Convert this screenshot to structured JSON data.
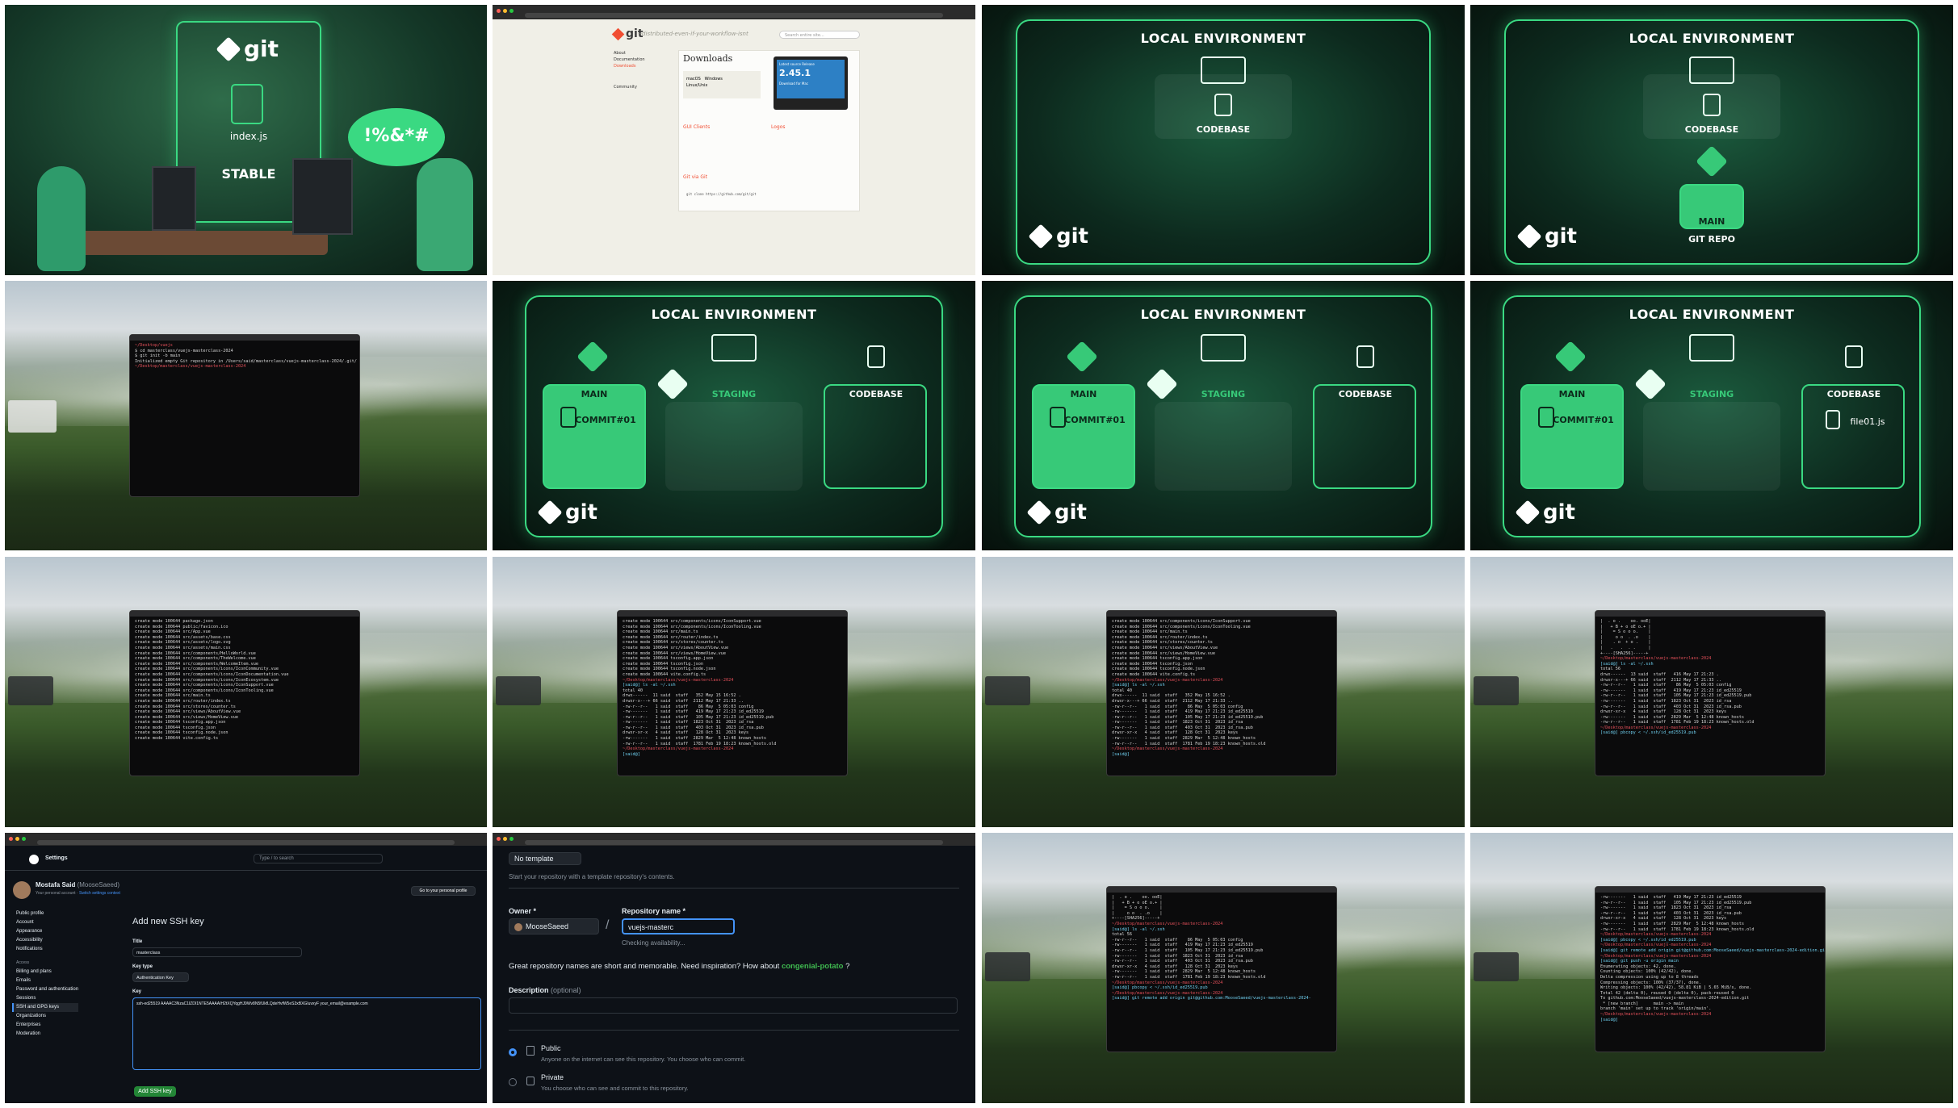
{
  "tile1": {
    "brand": "git",
    "file": "index.js",
    "status": "STABLE",
    "speech": "!%&*#"
  },
  "tile2": {
    "brand": "git",
    "tagline": "--distributed-even-if-your-workflow-isnt",
    "search_placeholder": "Search entire site...",
    "heading": "Downloads",
    "nav": [
      "About",
      "Documentation",
      "Downloads",
      "Community"
    ],
    "platforms": [
      "macOS",
      "Windows",
      "Linux/Unix"
    ],
    "release_label": "Latest source Release",
    "version": "2.45.1",
    "release_button": "Download for Mac",
    "gui_title": "GUI Clients",
    "logos_title": "Logos",
    "git_via_git": "Git via Git",
    "clone_cmd": "git clone https://github.com/git/git"
  },
  "slides": {
    "local_env": "LOCAL ENVIRONMENT",
    "codebase": "CODEBASE",
    "main": "MAIN",
    "git_repo": "GIT REPO",
    "staging": "STAGING",
    "commit": "COMMIT#01",
    "file": "file01.js",
    "brand": "git"
  },
  "terminals": {
    "t5": [
      {
        "p": "~/Desktop/vuejs",
        "c": ""
      },
      {
        "p": "",
        "c": "$ cd masterclass/vuejs-masterclass-2024"
      },
      {
        "p": "",
        "c": "$ git init -b main"
      },
      {
        "p": "",
        "c": "Initialized empty Git repository in /Users/said/masterclass/vuejs-masterclass-2024/.git/"
      },
      {
        "p": "~/Desktop/masterclass/vuejs-masterclass-2024",
        "c": ""
      }
    ],
    "t9": [
      "create mode 100644 package.json",
      "create mode 100644 public/favicon.ico",
      "create mode 100644 src/App.vue",
      "create mode 100644 src/assets/base.css",
      "create mode 100644 src/assets/logo.svg",
      "create mode 100644 src/assets/main.css",
      "create mode 100644 src/components/HelloWorld.vue",
      "create mode 100644 src/components/TheWelcome.vue",
      "create mode 100644 src/components/WelcomeItem.vue",
      "create mode 100644 src/components/icons/IconCommunity.vue",
      "create mode 100644 src/components/icons/IconDocumentation.vue",
      "create mode 100644 src/components/icons/IconEcosystem.vue",
      "create mode 100644 src/components/icons/IconSupport.vue",
      "create mode 100644 src/components/icons/IconTooling.vue",
      "create mode 100644 src/main.ts",
      "create mode 100644 src/router/index.ts",
      "create mode 100644 src/stores/counter.ts",
      "create mode 100644 src/views/AboutView.vue",
      "create mode 100644 src/views/HomeView.vue",
      "create mode 100644 tsconfig.app.json",
      "create mode 100644 tsconfig.json",
      "create mode 100644 tsconfig.node.json",
      "create mode 100644 vite.config.ts"
    ],
    "t10": [
      "create mode 100644 src/components/icons/IconSupport.vue",
      "create mode 100644 src/components/icons/IconTooling.vue",
      "create mode 100644 src/main.ts",
      "create mode 100644 src/router/index.ts",
      "create mode 100644 src/stores/counter.ts",
      "create mode 100644 src/views/AboutView.vue",
      "create mode 100644 src/views/HomeView.vue",
      "create mode 100644 tsconfig.app.json",
      "create mode 100644 tsconfig.json",
      "create mode 100644 tsconfig.node.json",
      "create mode 100644 vite.config.ts",
      "~/Desktop/masterclass/vuejs-masterclass-2024",
      "[said@] ls -al ~/.ssh",
      "total 40",
      "drwx------  11 said  staff   352 May 15 16:52 .",
      "drwxr-x---+ 66 said  staff  2112 May 17 21:33 ..",
      "-rw-r--r--   1 said  staff    86 May  5 05:03 config",
      "-rw-------   1 said  staff   419 May 17 21:23 id_ed25519",
      "-rw-r--r--   1 said  staff   105 May 17 21:23 id_ed25519.pub",
      "-rw-------   1 said  staff  1823 Oct 31  2023 id_rsa",
      "-rw-r--r--   1 said  staff   403 Oct 31  2023 id_rsa.pub",
      "drwxr-xr-x   4 said  staff   128 Oct 31  2023 keys",
      "-rw-------   1 said  staff  2829 Mar  5 12:48 known_hosts",
      "-rw-r--r--   1 said  staff  1781 Feb 19 18:23 known_hosts.old",
      "~/Desktop/masterclass/vuejs-masterclass-2024",
      "[said@] "
    ],
    "t12": [
      "|  . o .    oo. ooE|",
      "|   + B + o oE o.+ |",
      "|    = S o o o.    |",
      "|     o o  . .o    |",
      "|    . o  + o .    |",
      "|   .   .  . .     |",
      "+----[SHA256]-----+",
      "~/Desktop/masterclass/vuejs-masterclass-2024",
      "[said@] ls -al ~/.ssh",
      "total 56",
      "drwx------  13 said  staff   416 May 17 21:23 .",
      "drwxr-x---+ 66 said  staff  2112 May 17 21:33 ..",
      "-rw-r--r--   1 said  staff    86 May  5 05:03 config",
      "-rw-------   1 said  staff   419 May 17 21:23 id_ed25519",
      "-rw-r--r--   1 said  staff   105 May 17 21:23 id_ed25519.pub",
      "-rw-------   1 said  staff  1823 Oct 31  2023 id_rsa",
      "-rw-r--r--   1 said  staff   403 Oct 31  2023 id_rsa.pub",
      "drwxr-xr-x   4 said  staff   128 Oct 31  2023 keys",
      "-rw-------   1 said  staff  2829 Mar  5 12:48 known_hosts",
      "-rw-r--r--   1 said  staff  1781 Feb 19 18:23 known_hosts.old",
      "~/Desktop/masterclass/vuejs-masterclass-2024",
      "[said@] pbcopy < ~/.ssh/id_ed25519.pub"
    ],
    "t15": [
      "|  . o .    oo. ooE|",
      "|   + B + o oE o.+ |",
      "|    = S o o o.    |",
      "|     o o  . .o    |",
      "+----[SHA256]-----+",
      "~/Desktop/masterclass/vuejs-masterclass-2024",
      "[said@] ls -al ~/.ssh",
      "total 56",
      "-rw-r--r--   1 said  staff    86 May  5 05:03 config",
      "-rw-------   1 said  staff   419 May 17 21:23 id_ed25519",
      "-rw-r--r--   1 said  staff   105 May 17 21:23 id_ed25519.pub",
      "-rw-------   1 said  staff  1823 Oct 31  2023 id_rsa",
      "-rw-r--r--   1 said  staff   403 Oct 31  2023 id_rsa.pub",
      "drwxr-xr-x   4 said  staff   128 Oct 31  2023 keys",
      "-rw-------   1 said  staff  2829 Mar  5 12:48 known_hosts",
      "-rw-r--r--   1 said  staff  1781 Feb 19 18:23 known_hosts.old",
      "~/Desktop/masterclass/vuejs-masterclass-2024",
      "[said@] pbcopy < ~/.ssh/id_ed25519.pub",
      "~/Desktop/masterclass/vuejs-masterclass-2024",
      "[said@] git remote add origin git@github.com:MooseSaeed/vuejs-masterclass-2024-"
    ],
    "t16": [
      "-rw-------   1 said  staff   419 May 17 21:23 id_ed25519",
      "-rw-r--r--   1 said  staff   105 May 17 21:23 id_ed25519.pub",
      "-rw-------   1 said  staff  1823 Oct 31  2023 id_rsa",
      "-rw-r--r--   1 said  staff   403 Oct 31  2023 id_rsa.pub",
      "drwxr-xr-x   4 said  staff   128 Oct 31  2023 keys",
      "-rw-------   1 said  staff  2829 Mar  5 12:48 known_hosts",
      "-rw-r--r--   1 said  staff  1781 Feb 19 18:23 known_hosts.old",
      "~/Desktop/masterclass/vuejs-masterclass-2024",
      "[said@] pbcopy < ~/.ssh/id_ed25519.pub",
      "~/Desktop/masterclass/vuejs-masterclass-2024",
      "[said@] git remote add origin git@github.com:MooseSaeed/vuejs-masterclass-2024-edition.git",
      "~/Desktop/masterclass/vuejs-masterclass-2024",
      "[said@] git push -u origin main",
      "Enumerating objects: 42, done.",
      "Counting objects: 100% (42/42), done.",
      "Delta compression using up to 8 threads",
      "Compressing objects: 100% (37/37), done.",
      "Writing objects: 100% (42/42), 58.81 KiB | 5.65 MiB/s, done.",
      "Total 42 (delta 0), reused 0 (delta 0), pack-reused 0",
      "To github.com:MooseSaeed/vuejs-masterclass-2024-edition.git",
      " * [new branch]      main -> main",
      "branch 'main' set up to track 'origin/main'.",
      "~/Desktop/masterclass/vuejs-masterclass-2024",
      "[said@] "
    ]
  },
  "gh_settings": {
    "tab_title": "Add new SSH key",
    "header": "Settings",
    "search": "Type / to search",
    "user_name": "Mostafa Said",
    "user_handle": "(MooseSaeed)",
    "account_sub": "Your personal account",
    "switch": "Switch settings context",
    "profile_btn": "Go to your personal profile",
    "nav": [
      "Public profile",
      "Account",
      "Appearance",
      "Accessibility",
      "Notifications"
    ],
    "access_label": "Access",
    "nav2": [
      "Billing and plans",
      "Emails",
      "Password and authentication",
      "Sessions",
      "SSH and GPG keys",
      "Organizations",
      "Enterprises",
      "Moderation"
    ],
    "page_title": "Add new SSH key",
    "title_label": "Title",
    "title_value": "masterclass",
    "keytype_label": "Key type",
    "keytype_value": "Authentication Key",
    "key_label": "Key",
    "key_value": "ssh-ed25519 AAAAC3NzaC1lZDI1NTE5AAAAIH2tXQYqgHJ9Wv8N5fUkfLQdeHvfW5eS3xBXGIuvxyF your_email@example.com",
    "add_btn": "Add SSH key"
  },
  "gh_new_repo": {
    "template": "No template",
    "template_hint": "Start your repository with a template repository's contents.",
    "owner_label": "Owner *",
    "owner_value": "MooseSaeed",
    "repo_label": "Repository name *",
    "repo_value": "vuejs-masterc",
    "checking": "Checking availability...",
    "inspire": "Great repository names are short and memorable. Need inspiration? How about",
    "suggest": "congenial-potato",
    "desc_label": "Description",
    "optional": "(optional)",
    "public": "Public",
    "public_sub": "Anyone on the internet can see this repository. You choose who can commit.",
    "private": "Private",
    "private_sub": "You choose who can see and commit to this repository."
  },
  "colors": {
    "accent": "#3ad982",
    "accent_fill": "#37c978",
    "gh_bg": "#0d1117",
    "term_prompt": "#e4505a"
  }
}
